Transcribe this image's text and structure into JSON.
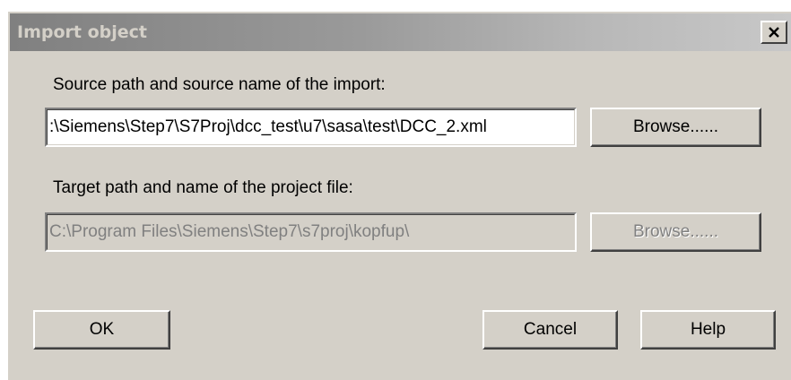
{
  "dialog": {
    "title": "Import object",
    "close_icon": "close-icon"
  },
  "source": {
    "label": "Source path and source name of the import:",
    "value": ":\\Siemens\\Step7\\S7Proj\\dcc_test\\u7\\sasa\\test\\DCC_2.xml",
    "browse_label": "Browse......"
  },
  "target": {
    "label": "Target path and name of the project file:",
    "value": "C:\\Program Files\\Siemens\\Step7\\s7proj\\kopfup\\",
    "browse_label": "Browse......"
  },
  "buttons": {
    "ok": "OK",
    "cancel": "Cancel",
    "help": "Help"
  },
  "colors": {
    "face": "#d4d0c8",
    "disabled_text": "#808080"
  }
}
